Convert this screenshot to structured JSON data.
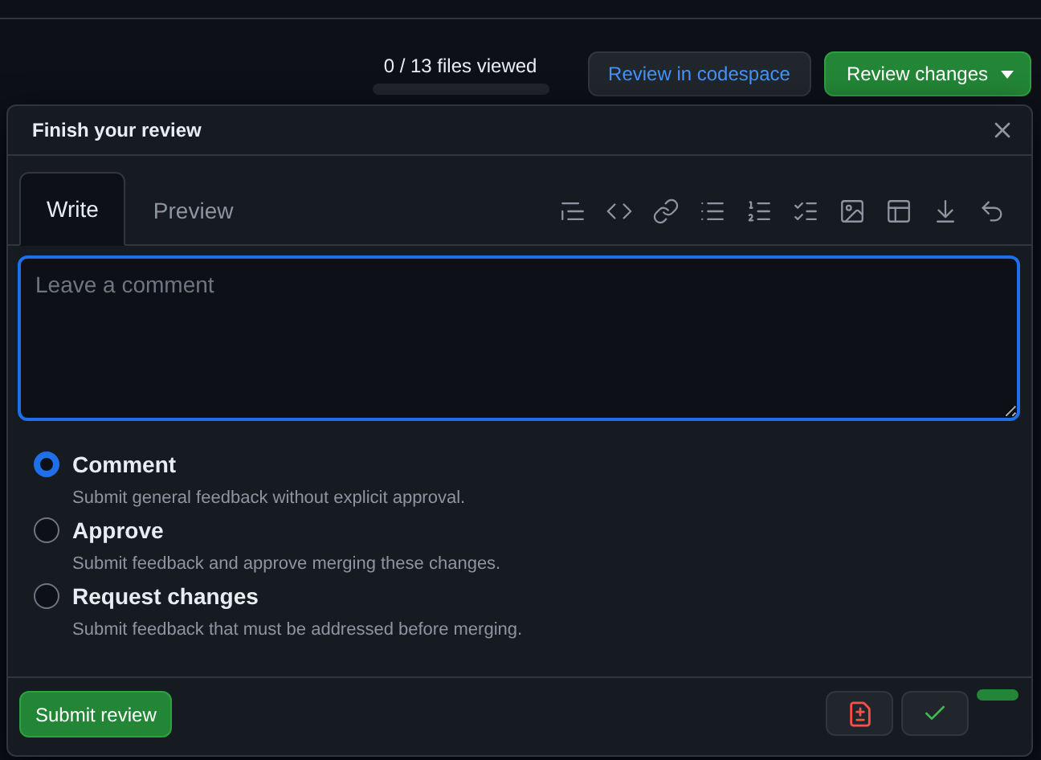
{
  "header": {
    "files_viewed": "0 / 13 files viewed",
    "progress": {
      "level": 0
    },
    "codespace_button": "Review in codespace",
    "review_button": "Review changes"
  },
  "dialog": {
    "title": "Finish your review",
    "tabs": [
      {
        "label": "Write",
        "selected": true
      },
      {
        "label": "Preview",
        "selected": false
      }
    ],
    "comment": {
      "placeholder": "Leave a comment"
    },
    "options": [
      {
        "label": "Comment",
        "description": "Submit general feedback without explicit approval.",
        "selected": true
      },
      {
        "label": "Approve",
        "description": "Submit feedback and approve merging these changes.",
        "selected": false
      },
      {
        "label": "Request changes",
        "description": "Submit feedback that must be addressed before merging.",
        "selected": false
      }
    ],
    "submit_button": "Submit review"
  }
}
